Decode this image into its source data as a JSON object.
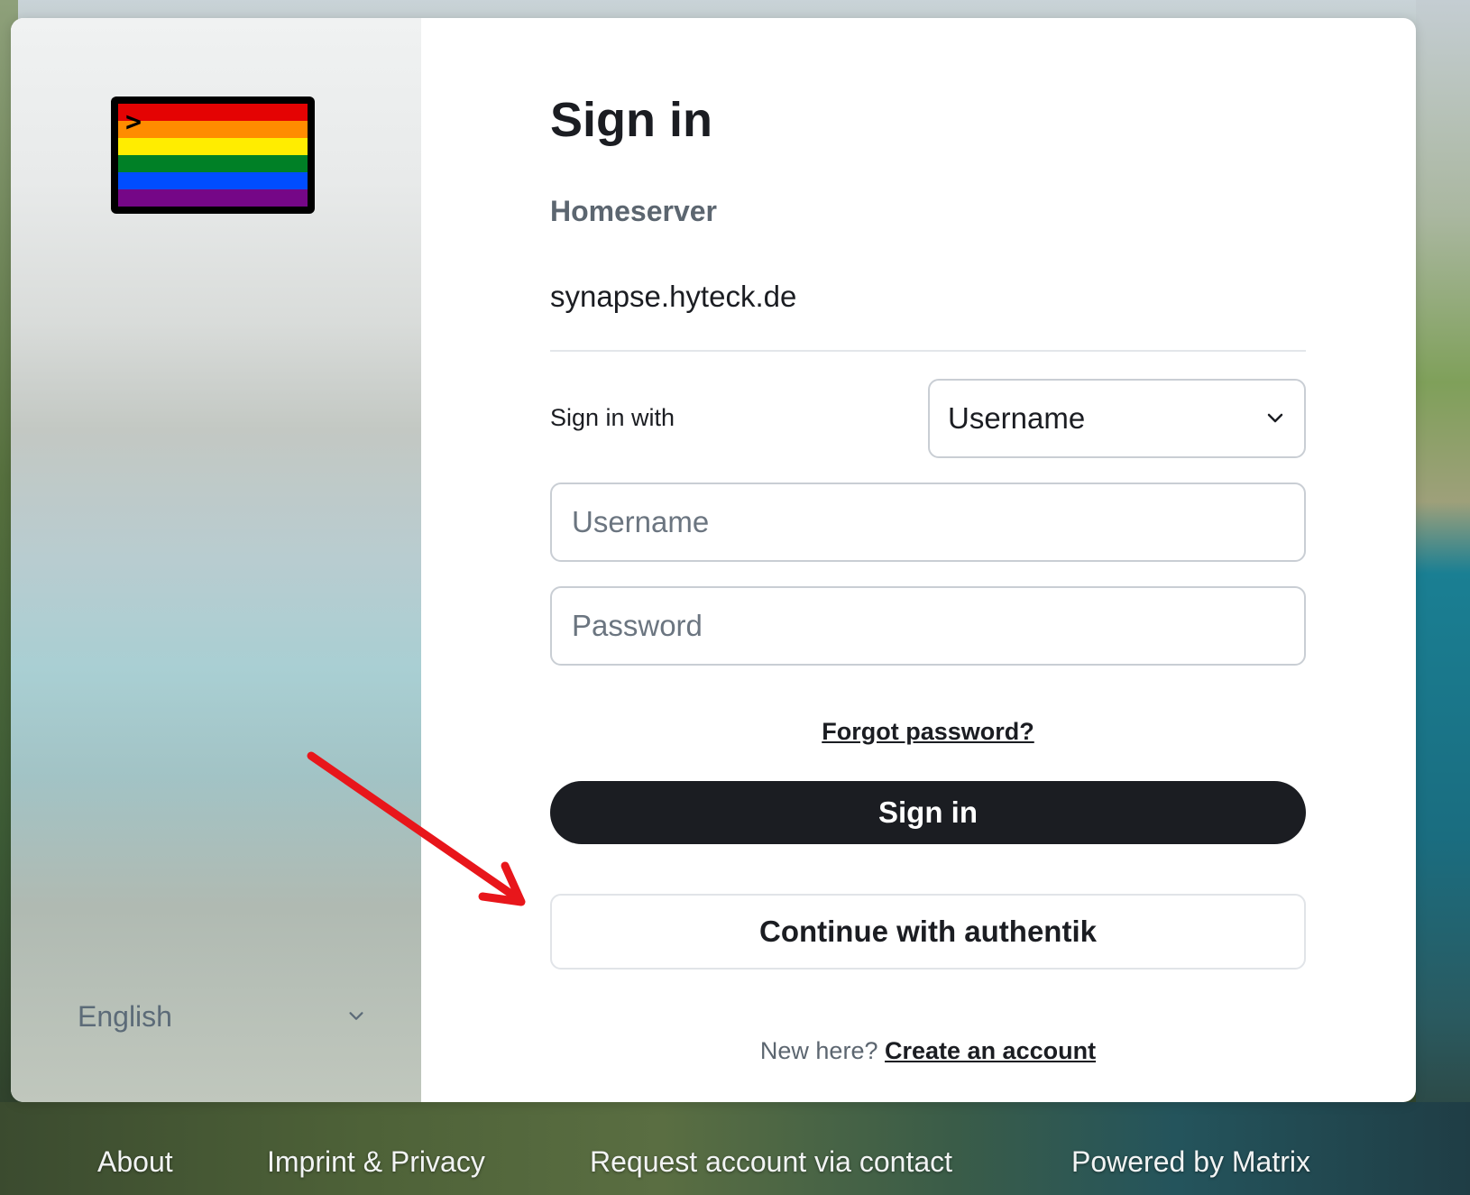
{
  "branding": {
    "logo_prompt": ">",
    "flag_colors": [
      "#e40303",
      "#ff8c00",
      "#ffed00",
      "#008026",
      "#004dff",
      "#750787"
    ]
  },
  "language": {
    "selected": "English"
  },
  "form": {
    "title": "Sign in",
    "homeserver_label": "Homeserver",
    "homeserver_value": "synapse.hyteck.de",
    "sign_in_with_label": "Sign in with",
    "sign_in_with_selected": "Username",
    "username_placeholder": "Username",
    "password_placeholder": "Password",
    "forgot_password": "Forgot password?",
    "sign_in_button": "Sign in",
    "sso_button": "Continue with authentik",
    "new_here": "New here?",
    "create_account": "Create an account"
  },
  "annotation": {
    "arrow_color": "#e8161b"
  },
  "footer": {
    "links": [
      "About",
      "Imprint & Privacy",
      "Request account via contact",
      "Powered by Matrix"
    ]
  }
}
